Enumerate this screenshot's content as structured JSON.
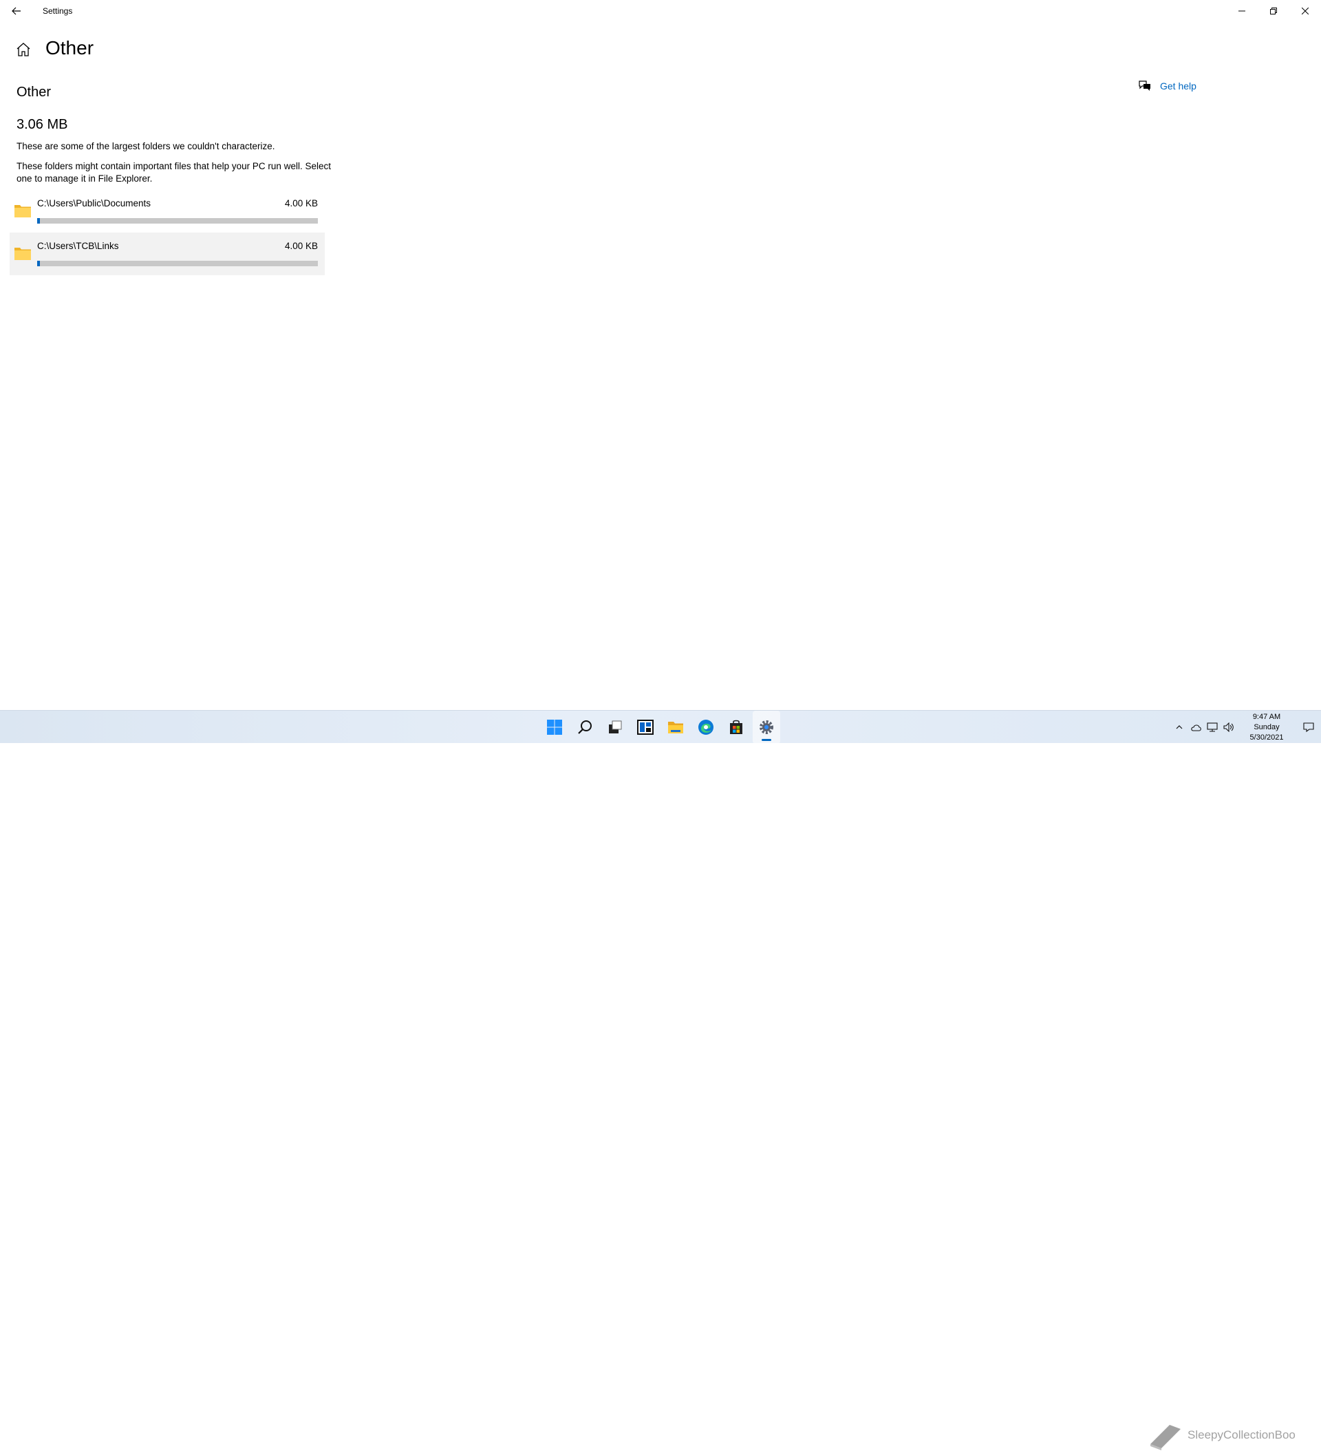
{
  "window": {
    "title": "Settings"
  },
  "header": {
    "title": "Other"
  },
  "section": {
    "title": "Other",
    "total_size": "3.06 MB",
    "description_1": "These are some of the largest folders we couldn't characterize.",
    "description_2": "These folders might contain important files that help your PC run well. Select one to manage it in File Explorer."
  },
  "folders": [
    {
      "path": "C:\\Users\\Public\\Documents",
      "size": "4.00 KB",
      "usage_fraction": 0.01
    },
    {
      "path": "C:\\Users\\TCB\\Links",
      "size": "4.00 KB",
      "usage_fraction": 0.01
    }
  ],
  "help": {
    "label": "Get help"
  },
  "taskbar": {
    "apps": [
      "start-icon",
      "search-icon",
      "task-view-icon",
      "widgets-icon",
      "file-explorer-icon",
      "edge-icon",
      "store-icon",
      "settings-icon"
    ],
    "active_app": "settings-icon",
    "clock": {
      "time": "9:47 AM",
      "day": "Sunday",
      "date": "5/30/2021"
    }
  },
  "watermark": {
    "text": "SleepyCollectionBoo"
  },
  "colors": {
    "accent": "#0067c0",
    "bar_track": "#c8c8c8",
    "hover": "#f2f2f2"
  }
}
